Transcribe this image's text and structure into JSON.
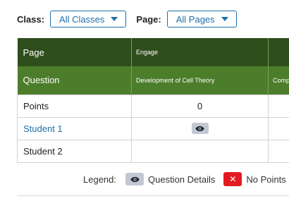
{
  "filters": {
    "class_label": "Class:",
    "class_value": "All Classes",
    "page_label": "Page:",
    "page_value": "All Pages"
  },
  "grid": {
    "page_header": "Page",
    "page_columns": [
      "Engage",
      ""
    ],
    "question_header": "Question",
    "question_columns": [
      "Development of Cell Theory",
      "Comp"
    ],
    "rows": [
      {
        "name": "Points",
        "value": "0"
      },
      {
        "name": "Student 1",
        "icon": "eye-icon"
      },
      {
        "name": "Student 2",
        "value": ""
      }
    ]
  },
  "legend": {
    "label": "Legend:",
    "question_details": "Question Details",
    "no_points": "No Points",
    "no_points_glyph": "✕",
    "colors": {
      "eye_bg": "#c2c8d2",
      "no_points_bg": "#e21b22"
    }
  },
  "colors": {
    "page_header_bg": "#2e4e1b",
    "question_header_bg": "#4c7d2b",
    "link": "#1f6ea8"
  }
}
